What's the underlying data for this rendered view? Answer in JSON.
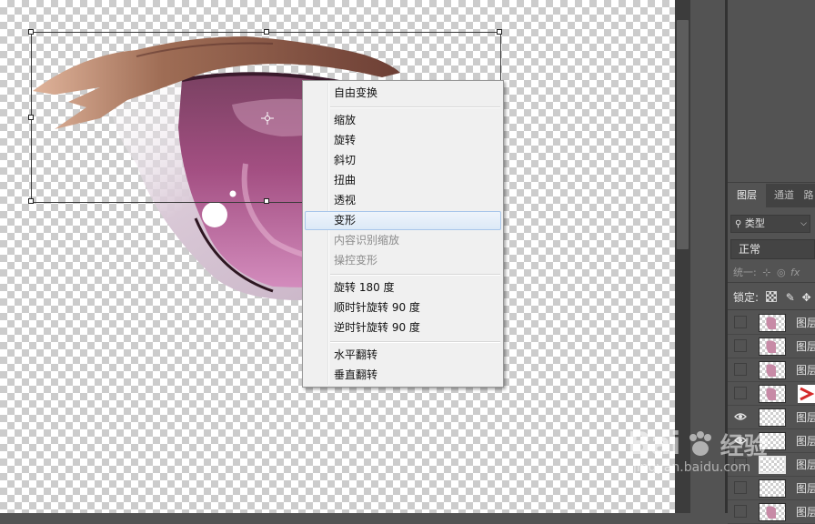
{
  "context_menu": {
    "items": [
      {
        "label": "自由变换",
        "state": "normal"
      },
      {
        "label": "缩放",
        "state": "normal"
      },
      {
        "label": "旋转",
        "state": "normal"
      },
      {
        "label": "斜切",
        "state": "normal"
      },
      {
        "label": "扭曲",
        "state": "normal"
      },
      {
        "label": "透视",
        "state": "normal"
      },
      {
        "label": "变形",
        "state": "hover"
      },
      {
        "label": "内容识别缩放",
        "state": "disabled"
      },
      {
        "label": "操控变形",
        "state": "disabled"
      },
      {
        "label": "旋转 180 度",
        "state": "normal"
      },
      {
        "label": "顺时针旋转 90 度",
        "state": "normal"
      },
      {
        "label": "逆时针旋转 90 度",
        "state": "normal"
      },
      {
        "label": "水平翻转",
        "state": "normal"
      },
      {
        "label": "垂直翻转",
        "state": "normal"
      }
    ]
  },
  "layers_panel": {
    "tabs": [
      "图层",
      "通道"
    ],
    "active_tab": "图层",
    "filter_kind": "类型",
    "blend_mode": "正常",
    "unify_label": "统一:",
    "lock_label": "锁定:",
    "layers": [
      {
        "name": "图层",
        "visible": false
      },
      {
        "name": "图层",
        "visible": false
      },
      {
        "name": "图层",
        "visible": false
      },
      {
        "name": "图层",
        "visible": false
      },
      {
        "name": "图层",
        "visible": true
      },
      {
        "name": "图层",
        "visible": true
      },
      {
        "name": "图层",
        "visible": false
      },
      {
        "name": "图层",
        "visible": false
      },
      {
        "name": "图层",
        "visible": false
      }
    ]
  },
  "watermark": {
    "brand": "Bai",
    "brand2": "经验",
    "url": "jingyan.baidu.com"
  },
  "colors": {
    "accent_red": "#d42a2a",
    "menu_bg": "#f0f0f0",
    "panel_bg": "#535353",
    "iris": "#b9608e"
  }
}
